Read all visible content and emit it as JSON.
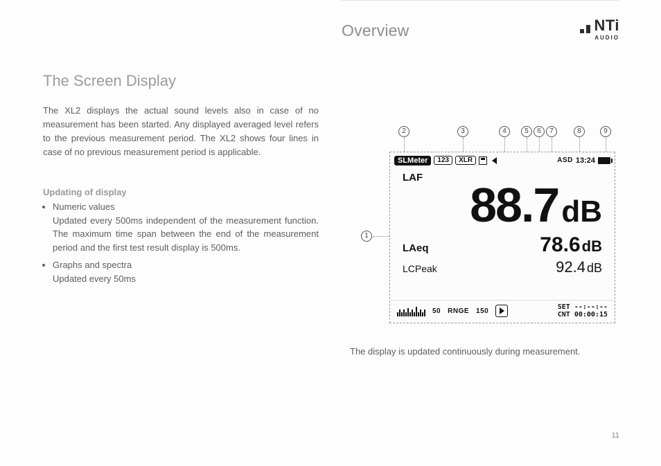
{
  "header": {
    "title": "Overview",
    "logo_text": "NTi",
    "logo_sub": "AUDIO"
  },
  "section": {
    "title": "The Screen Display",
    "intro": "The XL2 displays the actual sound levels also in case of no measurement has been started. Any displayed averaged level refers to the previous measurement period. The XL2 shows four lines in case of no previous measurement period is applicable.",
    "sub_head": "Updating of display",
    "bullet1_title": "Numeric values",
    "bullet1_detail": "Updated every 500ms independent of the measurement function. The maximum time span between the end of the measurement period and the first test result display is 500ms.",
    "bullet2_title": "Graphs and spectra",
    "bullet2_detail": "Updated every 50ms"
  },
  "caption": "The display is updated continuously during measurement.",
  "page_number": "11",
  "callouts": [
    "1",
    "2",
    "3",
    "4",
    "5",
    "6",
    "7",
    "8",
    "9"
  ],
  "display": {
    "mode": "SLMeter",
    "page": "123",
    "input": "XLR",
    "asd": "ASD",
    "clock": "13:24",
    "laf_label": "LAF",
    "laf_value": "88.7",
    "laf_unit": "dB",
    "laeq_label": "LAeq",
    "laeq_value": "78.6",
    "laeq_unit": "dB",
    "lcpeak_label": "LCPeak",
    "lcpeak_value": "92.4",
    "lcpeak_unit": "dB",
    "range_low": "50",
    "range_label": "RNGE",
    "range_high": "150",
    "set_label": "SET",
    "set_value": "--:--:--",
    "cnt_label": "CNT",
    "cnt_value": "00:00:15"
  }
}
